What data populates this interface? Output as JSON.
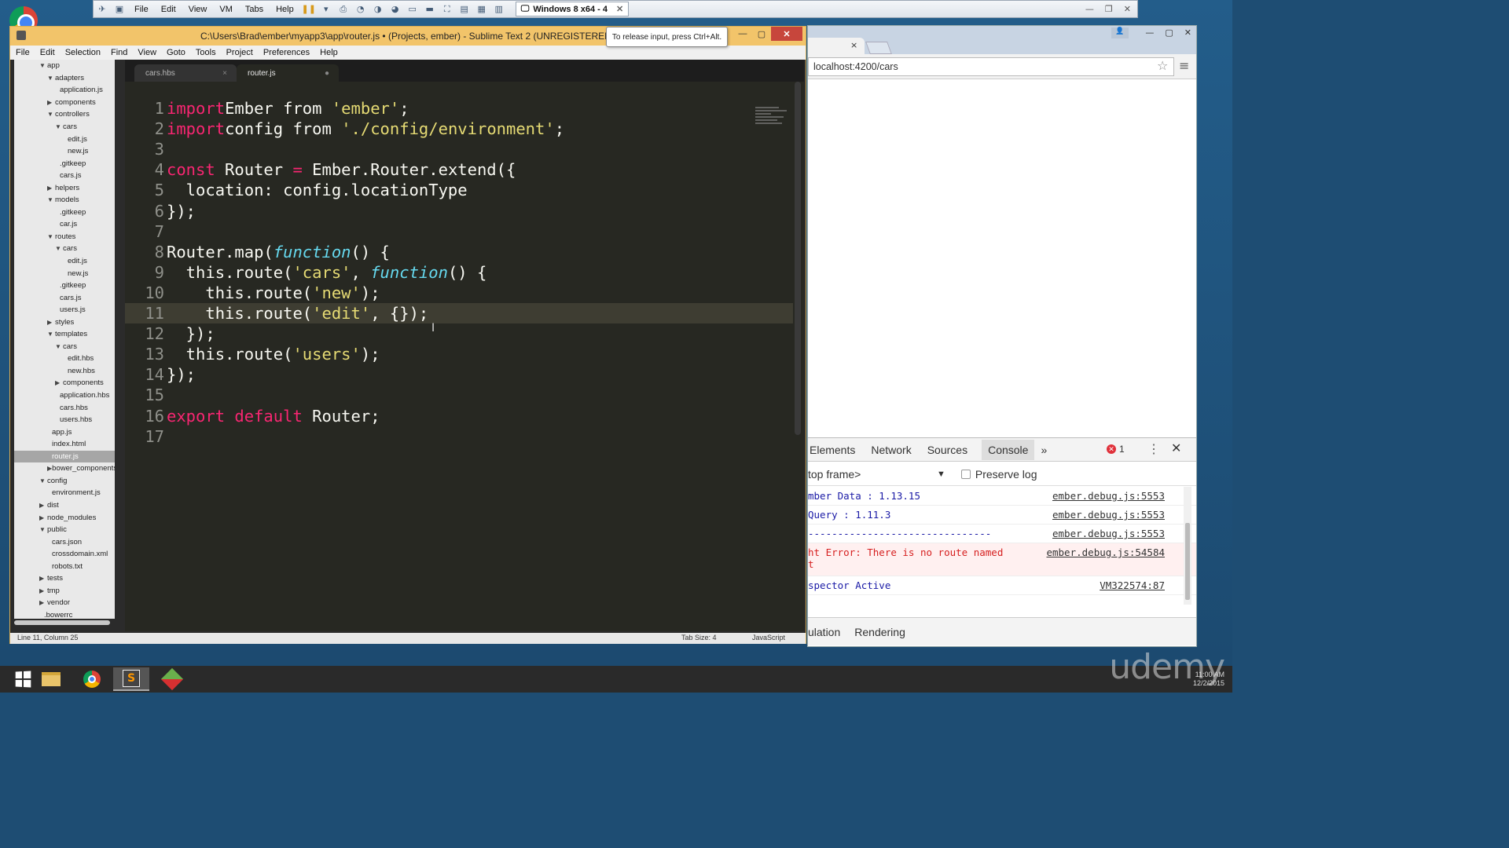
{
  "vmware": {
    "menu": [
      "File",
      "Edit",
      "View",
      "VM",
      "Tabs",
      "Help"
    ],
    "tab_label": "Windows 8 x64 - 4",
    "release_tip": "To release input, press Ctrl+Alt."
  },
  "sublime": {
    "title": "C:\\Users\\Brad\\ember\\myapp3\\app\\router.js • (Projects, ember) - Sublime Text 2 (UNREGISTERED)",
    "menu": [
      "File",
      "Edit",
      "Selection",
      "Find",
      "View",
      "Goto",
      "Tools",
      "Project",
      "Preferences",
      "Help"
    ],
    "tabs": [
      {
        "label": "cars.hbs",
        "marker": "×"
      },
      {
        "label": "router.js",
        "marker": "●"
      }
    ],
    "sidebar": [
      {
        "label": "app",
        "arrow": "▼",
        "depth": 0
      },
      {
        "label": "adapters",
        "arrow": "▼",
        "depth": 1
      },
      {
        "label": "application.js",
        "arrow": "",
        "depth": 3
      },
      {
        "label": "components",
        "arrow": "▶",
        "depth": 1
      },
      {
        "label": "controllers",
        "arrow": "▼",
        "depth": 1
      },
      {
        "label": "cars",
        "arrow": "▼",
        "depth": 2
      },
      {
        "label": "edit.js",
        "arrow": "",
        "depth": 4
      },
      {
        "label": "new.js",
        "arrow": "",
        "depth": 4
      },
      {
        "label": ".gitkeep",
        "arrow": "",
        "depth": 3
      },
      {
        "label": "cars.js",
        "arrow": "",
        "depth": 3
      },
      {
        "label": "helpers",
        "arrow": "▶",
        "depth": 1
      },
      {
        "label": "models",
        "arrow": "▼",
        "depth": 1
      },
      {
        "label": ".gitkeep",
        "arrow": "",
        "depth": 3
      },
      {
        "label": "car.js",
        "arrow": "",
        "depth": 3
      },
      {
        "label": "routes",
        "arrow": "▼",
        "depth": 1
      },
      {
        "label": "cars",
        "arrow": "▼",
        "depth": 2
      },
      {
        "label": "edit.js",
        "arrow": "",
        "depth": 4
      },
      {
        "label": "new.js",
        "arrow": "",
        "depth": 4
      },
      {
        "label": ".gitkeep",
        "arrow": "",
        "depth": 3
      },
      {
        "label": "cars.js",
        "arrow": "",
        "depth": 3
      },
      {
        "label": "users.js",
        "arrow": "",
        "depth": 3
      },
      {
        "label": "styles",
        "arrow": "▶",
        "depth": 1
      },
      {
        "label": "templates",
        "arrow": "▼",
        "depth": 1
      },
      {
        "label": "cars",
        "arrow": "▼",
        "depth": 2
      },
      {
        "label": "edit.hbs",
        "arrow": "",
        "depth": 4
      },
      {
        "label": "new.hbs",
        "arrow": "",
        "depth": 4
      },
      {
        "label": "components",
        "arrow": "▶",
        "depth": 2
      },
      {
        "label": "application.hbs",
        "arrow": "",
        "depth": 3
      },
      {
        "label": "cars.hbs",
        "arrow": "",
        "depth": 3
      },
      {
        "label": "users.hbs",
        "arrow": "",
        "depth": 3
      },
      {
        "label": "app.js",
        "arrow": "",
        "depth": 2
      },
      {
        "label": "index.html",
        "arrow": "",
        "depth": 2
      },
      {
        "label": "router.js",
        "arrow": "",
        "depth": 2,
        "selected": true
      },
      {
        "label": "bower_components",
        "arrow": "▶",
        "depth": 1
      },
      {
        "label": "config",
        "arrow": "▼",
        "depth": 0
      },
      {
        "label": "environment.js",
        "arrow": "",
        "depth": 2
      },
      {
        "label": "dist",
        "arrow": "▶",
        "depth": 0
      },
      {
        "label": "node_modules",
        "arrow": "▶",
        "depth": 0
      },
      {
        "label": "public",
        "arrow": "▼",
        "depth": 0
      },
      {
        "label": "cars.json",
        "arrow": "",
        "depth": 2
      },
      {
        "label": "crossdomain.xml",
        "arrow": "",
        "depth": 2
      },
      {
        "label": "robots.txt",
        "arrow": "",
        "depth": 2
      },
      {
        "label": "tests",
        "arrow": "▶",
        "depth": 0
      },
      {
        "label": "tmp",
        "arrow": "▶",
        "depth": 0
      },
      {
        "label": "vendor",
        "arrow": "▶",
        "depth": 0
      },
      {
        "label": ".bowerrc",
        "arrow": "",
        "depth": 1
      }
    ],
    "code_lines": [
      [
        [
          "kw",
          "import"
        ],
        [
          "",
          "Ember "
        ],
        [
          "",
          "from "
        ],
        [
          "str",
          "'ember'"
        ],
        [
          "",
          ";"
        ]
      ],
      [
        [
          "kw",
          "import"
        ],
        [
          "",
          "config "
        ],
        [
          "",
          "from "
        ],
        [
          "str",
          "'./config/environment'"
        ],
        [
          "",
          ";"
        ]
      ],
      [],
      [
        [
          "kw",
          "const"
        ],
        [
          "",
          " Router "
        ],
        [
          "kw",
          "="
        ],
        [
          "",
          " Ember.Router.extend({"
        ]
      ],
      [
        [
          "",
          "  location: config.locationType"
        ]
      ],
      [
        [
          "",
          "});"
        ]
      ],
      [],
      [
        [
          "",
          "Router.map("
        ],
        [
          "fn",
          "function"
        ],
        [
          "",
          "() {"
        ]
      ],
      [
        [
          "",
          "  this.route("
        ],
        [
          "str",
          "'cars'"
        ],
        [
          "",
          ", "
        ],
        [
          "fn",
          "function"
        ],
        [
          "",
          "() {"
        ]
      ],
      [
        [
          "",
          "    this.route("
        ],
        [
          "str",
          "'new'"
        ],
        [
          "",
          ");"
        ]
      ],
      [
        [
          "",
          "    this.route("
        ],
        [
          "str",
          "'edit'"
        ],
        [
          "",
          ", {}"
        ],
        [
          "",
          ");"
        ]
      ],
      [
        [
          "",
          "  });"
        ]
      ],
      [
        [
          "",
          "  this.route("
        ],
        [
          "str",
          "'users'"
        ],
        [
          "",
          ");"
        ]
      ],
      [
        [
          "",
          "});"
        ]
      ],
      [],
      [
        [
          "kw",
          "export"
        ],
        [
          "",
          " "
        ],
        [
          "kw",
          "default"
        ],
        [
          "",
          " Router;"
        ]
      ],
      []
    ],
    "current_line": 11,
    "status": {
      "position": "Line 11, Column 25",
      "tab_size": "Tab Size: 4",
      "syntax": "JavaScript"
    }
  },
  "chrome": {
    "tab_close": "×",
    "url": "localhost:4200/cars",
    "devtools": {
      "tabs": [
        "Elements",
        "Network",
        "Sources",
        "Console"
      ],
      "active_tab": "Console",
      "more": "»",
      "error_count": "1",
      "frame": "top frame>",
      "preserve_log": "Preserve log",
      "console": [
        {
          "msg": "mber Data : 1.13.15",
          "src": "ember.debug.js:5553",
          "type": "info"
        },
        {
          "msg": "Query     : 1.11.3",
          "src": "ember.debug.js:5553",
          "type": "info"
        },
        {
          "msg": "-------------------------------",
          "src": "ember.debug.js:5553",
          "type": "info"
        },
        {
          "msg": "ht Error: There is no route named\nt",
          "src": "ember.debug.js:54584",
          "type": "error"
        },
        {
          "msg": "spector Active",
          "src": "VM322574:87",
          "type": "info"
        }
      ],
      "drawer_tabs": [
        "ulation",
        "Rendering"
      ]
    }
  },
  "taskbar": {
    "time": "11:00 AM",
    "date": "12/2/2015"
  },
  "watermark": "udemy"
}
